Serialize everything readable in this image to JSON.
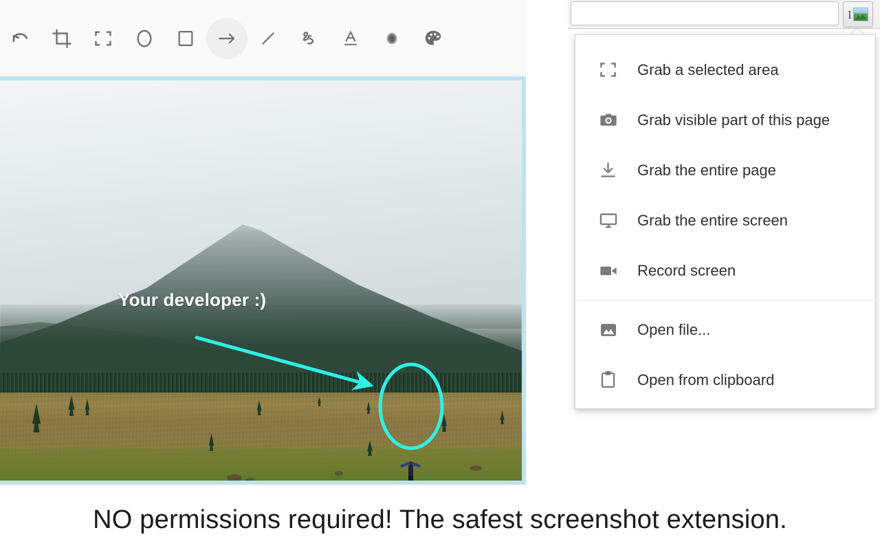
{
  "editor": {
    "toolbar": {
      "name": "annotation-toolbar",
      "selected_tool": "arrow",
      "tools": [
        {
          "id": "undo",
          "icon": "undo-icon",
          "label": "Undo"
        },
        {
          "id": "crop",
          "icon": "crop-icon",
          "label": "Crop"
        },
        {
          "id": "select",
          "icon": "select-area-icon",
          "label": "Select area"
        },
        {
          "id": "ellipse",
          "icon": "ellipse-icon",
          "label": "Ellipse"
        },
        {
          "id": "rectangle",
          "icon": "rectangle-icon",
          "label": "Rectangle"
        },
        {
          "id": "arrow",
          "icon": "arrow-icon",
          "label": "Arrow"
        },
        {
          "id": "line",
          "icon": "line-icon",
          "label": "Line"
        },
        {
          "id": "pencil",
          "icon": "pencil-icon",
          "label": "Pencil"
        },
        {
          "id": "text",
          "icon": "text-icon",
          "label": "Text"
        },
        {
          "id": "blur",
          "icon": "blur-icon",
          "label": "Blur"
        },
        {
          "id": "palette",
          "icon": "palette-icon",
          "label": "Color palette"
        }
      ]
    },
    "canvas": {
      "border_color": "#bfe2ef",
      "annotation_color": "#2ff0e6",
      "text_annotation": "Your developer :)"
    }
  },
  "tagline": "NO permissions required! The safest screenshot extension.",
  "browser": {
    "omnibox": {
      "value": "",
      "placeholder": ""
    },
    "extension_button": {
      "icon": "screenshot-extension-icon",
      "label": ""
    }
  },
  "menu": {
    "groups": [
      {
        "items": [
          {
            "icon": "select-area-icon",
            "label": "Grab a selected area"
          },
          {
            "icon": "camera-icon",
            "label": "Grab visible part of this page"
          },
          {
            "icon": "download-page-icon",
            "label": "Grab the entire page"
          },
          {
            "icon": "monitor-icon",
            "label": "Grab the entire screen"
          },
          {
            "icon": "video-camera-icon",
            "label": "Record screen"
          }
        ]
      },
      {
        "items": [
          {
            "icon": "image-file-icon",
            "label": "Open file..."
          },
          {
            "icon": "clipboard-icon",
            "label": "Open from clipboard"
          }
        ]
      }
    ]
  }
}
